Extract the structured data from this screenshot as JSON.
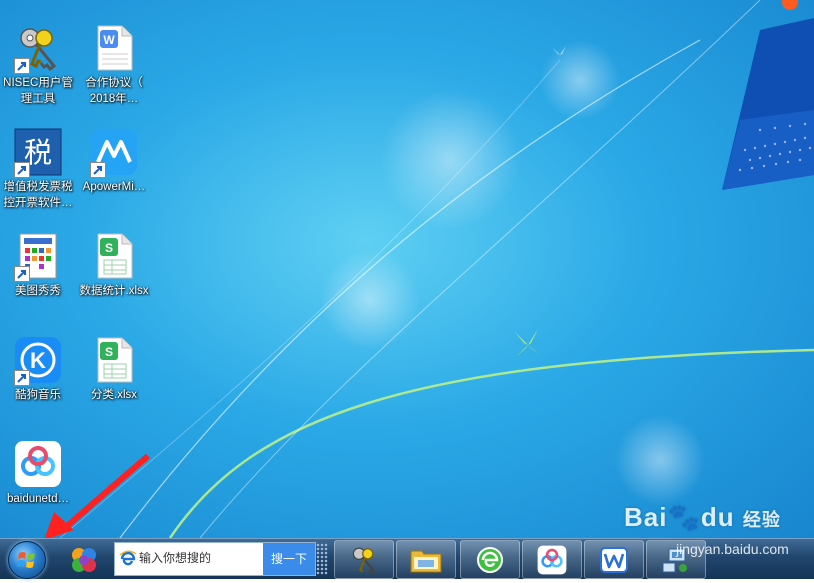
{
  "desktop": {
    "icons": [
      {
        "label_line1": "NISEC用户管",
        "label_line2": "理工具",
        "icon": "keys-icon"
      },
      {
        "label_line1": "合作协议（",
        "label_line2": "2018年…",
        "icon": "wps-doc-icon"
      },
      {
        "label_line1": "增值税发票税",
        "label_line2": "控开票软件…",
        "icon": "tax-icon"
      },
      {
        "label_line1": "ApowerMi…",
        "label_line2": "",
        "icon": "apowermirror-icon"
      },
      {
        "label_line1": "美图秀秀",
        "label_line2": "",
        "icon": "meitu-icon"
      },
      {
        "label_line1": "数据统计.xlsx",
        "label_line2": "",
        "icon": "wps-sheet-icon"
      },
      {
        "label_line1": "酷狗音乐",
        "label_line2": "",
        "icon": "kugou-icon"
      },
      {
        "label_line1": "分类.xlsx",
        "label_line2": "",
        "icon": "wps-sheet-icon"
      },
      {
        "label_line1": "baidunetd…",
        "label_line2": "",
        "icon": "baidu-netdisk-icon"
      }
    ]
  },
  "taskbar": {
    "search_placeholder": "输入你想搜的",
    "search_button": "搜一下",
    "apps": [
      "color-balls-icon",
      "keys-icon",
      "folder-icon",
      "browser-icon",
      "baidu-netdisk-icon",
      "wps-icon",
      "network-icon"
    ]
  },
  "watermark": {
    "brand": "Bai",
    "brand2": "du",
    "jingyan": "经验",
    "url": "jingyan.baidu.com"
  },
  "colors": {
    "desktop_blue": "#2aa8e6",
    "taskbar": "#21466e",
    "search_button": "#3a8bea"
  }
}
